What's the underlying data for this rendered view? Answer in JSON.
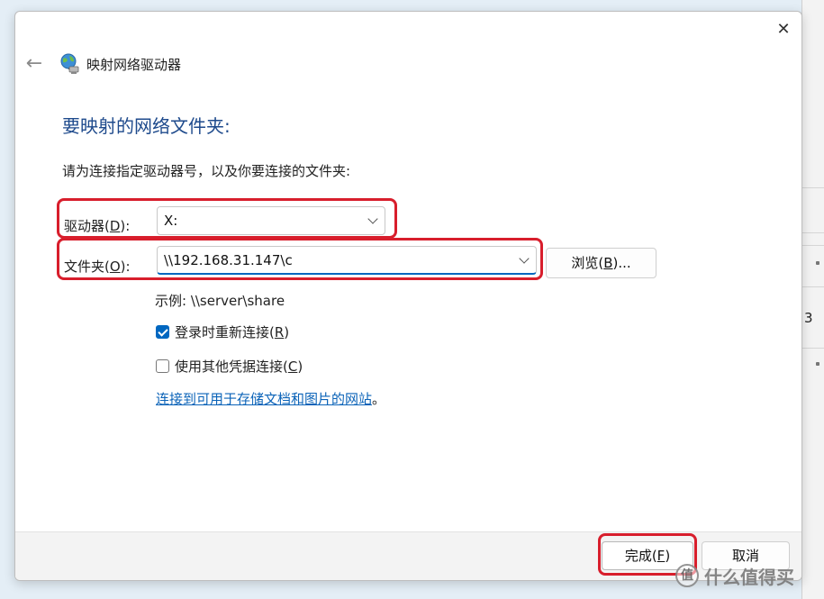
{
  "window": {
    "title": "映射网络驱动器",
    "close_symbol": "✕",
    "back_symbol": "←"
  },
  "heading": "要映射的网络文件夹:",
  "instruction": "请为连接指定驱动器号，以及你要连接的文件夹:",
  "drive": {
    "label_prefix": "驱动器(",
    "label_key": "D",
    "label_suffix": "):",
    "value": "X:"
  },
  "folder": {
    "label_prefix": "文件夹(",
    "label_key": "O",
    "label_suffix": "):",
    "value": "\\\\192.168.31.147\\c"
  },
  "browse_button": {
    "prefix": "浏览(",
    "key": "B",
    "suffix": ")..."
  },
  "example": "示例: \\\\server\\share",
  "reconnect": {
    "checked": true,
    "prefix": "登录时重新连接(",
    "key": "R",
    "suffix": ")"
  },
  "credentials": {
    "checked": false,
    "prefix": "使用其他凭据连接(",
    "key": "C",
    "suffix": ")"
  },
  "link": {
    "text": "连接到可用于存储文档和图片的网站",
    "tail": "。"
  },
  "finish_button": {
    "prefix": "完成(",
    "key": "F",
    "suffix": ")"
  },
  "cancel_button": "取消",
  "background_window": {
    "char": "3"
  },
  "watermark": {
    "badge": "值",
    "text": "什么值得买"
  },
  "colors": {
    "highlight": "#d81e2c",
    "heading": "#1e4a8c",
    "accent": "#0067c0",
    "link": "#0b63b8"
  }
}
